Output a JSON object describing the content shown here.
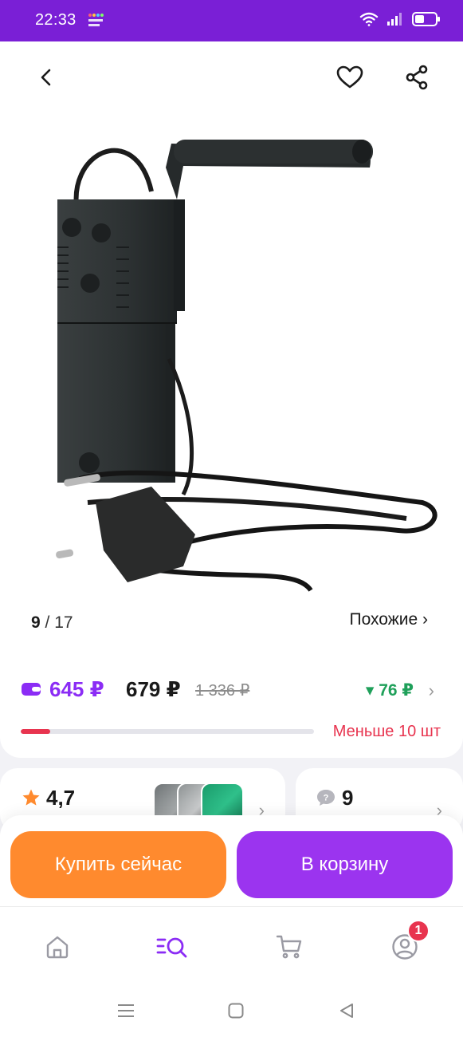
{
  "status_bar": {
    "time": "22:33",
    "battery_icon": "battery-icon",
    "wifi_icon": "wifi-icon",
    "signal_icon": "signal-icon"
  },
  "header": {
    "back_icon": "chevron-left-icon",
    "favorite_icon": "heart-icon",
    "share_icon": "share-icon"
  },
  "gallery": {
    "current": "9",
    "separator": "/",
    "total": "17",
    "similar_label": "Похожие ›"
  },
  "price": {
    "card_price": "645 ₽",
    "price": "679 ₽",
    "old_price": "1 336 ₽",
    "cashback": "▾ 76 ₽",
    "stock_text": "Меньше 10 шт",
    "stock_fraction": 0.1
  },
  "rating_card": {
    "rating": "4,7"
  },
  "questions_card": {
    "count": "9"
  },
  "actions": {
    "buy_now": "Купить сейчас",
    "add_to_cart": "В корзину"
  },
  "bottom_nav": {
    "items": [
      "home-icon",
      "catalog-search-icon",
      "cart-icon",
      "profile-icon"
    ],
    "profile_badge": "1"
  },
  "colors": {
    "brand_purple": "#7a1fd6",
    "price_purple": "#8b2cf5",
    "buy_orange": "#ff8a2e",
    "cart_purple": "#9b34ef",
    "red": "#e8344f",
    "green": "#1fa05a"
  }
}
